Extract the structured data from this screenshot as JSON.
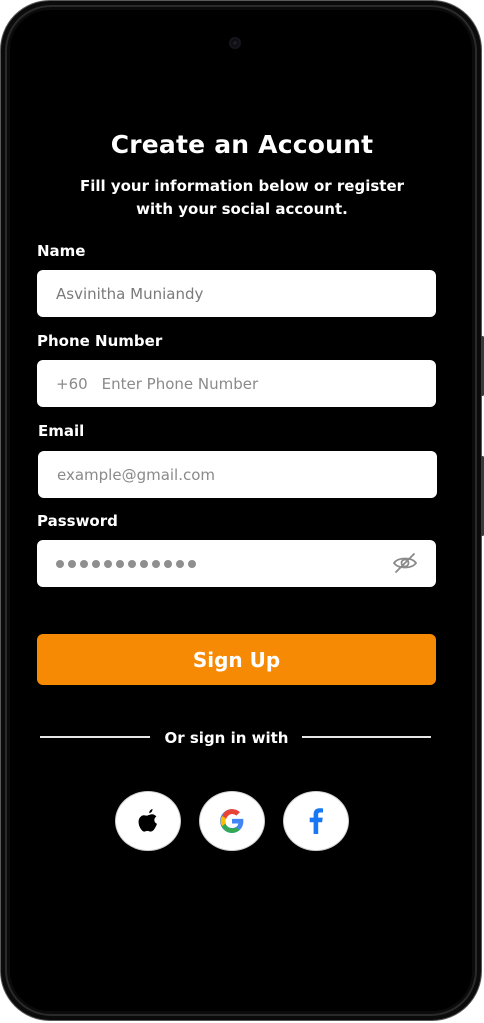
{
  "header": {
    "title": "Create an Account",
    "subtitle": "Fill your information below or register  with your social account."
  },
  "form": {
    "name": {
      "label": "Name",
      "value": "Asvinitha Muniandy"
    },
    "phone": {
      "label": "Phone Number",
      "prefix": "+60",
      "placeholder": "Enter Phone Number"
    },
    "email": {
      "label": "Email",
      "placeholder": "example@gmail.com"
    },
    "password": {
      "label": "Password",
      "masked_length": 12,
      "toggle_icon": "eye-slash-icon"
    }
  },
  "actions": {
    "signup_label": "Sign Up"
  },
  "divider": {
    "text": "Or  sign in with"
  },
  "social": [
    {
      "name": "apple",
      "icon": "apple-icon"
    },
    {
      "name": "google",
      "icon": "google-icon"
    },
    {
      "name": "facebook",
      "icon": "facebook-icon"
    }
  ],
  "colors": {
    "accent": "#f78a05",
    "background": "#000000",
    "field_bg": "#ffffff",
    "facebook_blue": "#1877f2"
  }
}
